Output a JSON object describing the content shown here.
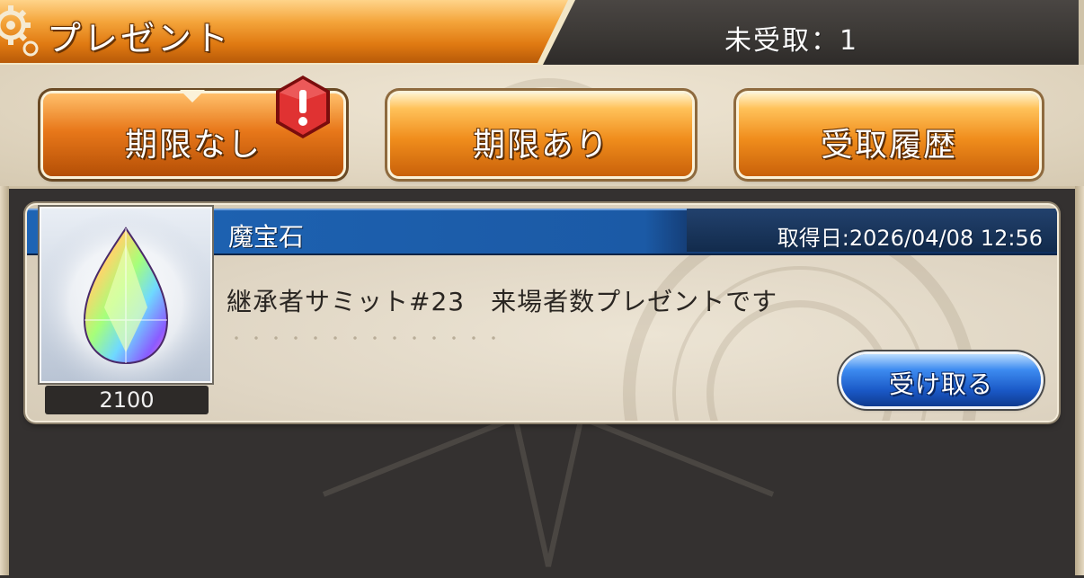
{
  "header": {
    "title": "プレゼント",
    "unclaimed_label": "未受取：1",
    "icon": "gear-icon"
  },
  "tabs": [
    {
      "label": "期限なし",
      "active": true,
      "alert": true
    },
    {
      "label": "期限あり",
      "active": false,
      "alert": false
    },
    {
      "label": "受取履歴",
      "active": false,
      "alert": false
    }
  ],
  "items": [
    {
      "name": "魔宝石",
      "date": "取得日:2026/04/08 12:56",
      "message": "継承者サミット#23　来場者数プレゼントです",
      "quantity": "2100",
      "icon": "gem-icon",
      "button_label": "受け取る"
    }
  ],
  "colors": {
    "header_orange": "#e07a12",
    "tab_orange": "#f08d1c",
    "title_bar_blue": "#1e64b4",
    "button_blue": "#1a58c6",
    "alert_red": "#d42a2a",
    "panel_dark": "#343130"
  }
}
